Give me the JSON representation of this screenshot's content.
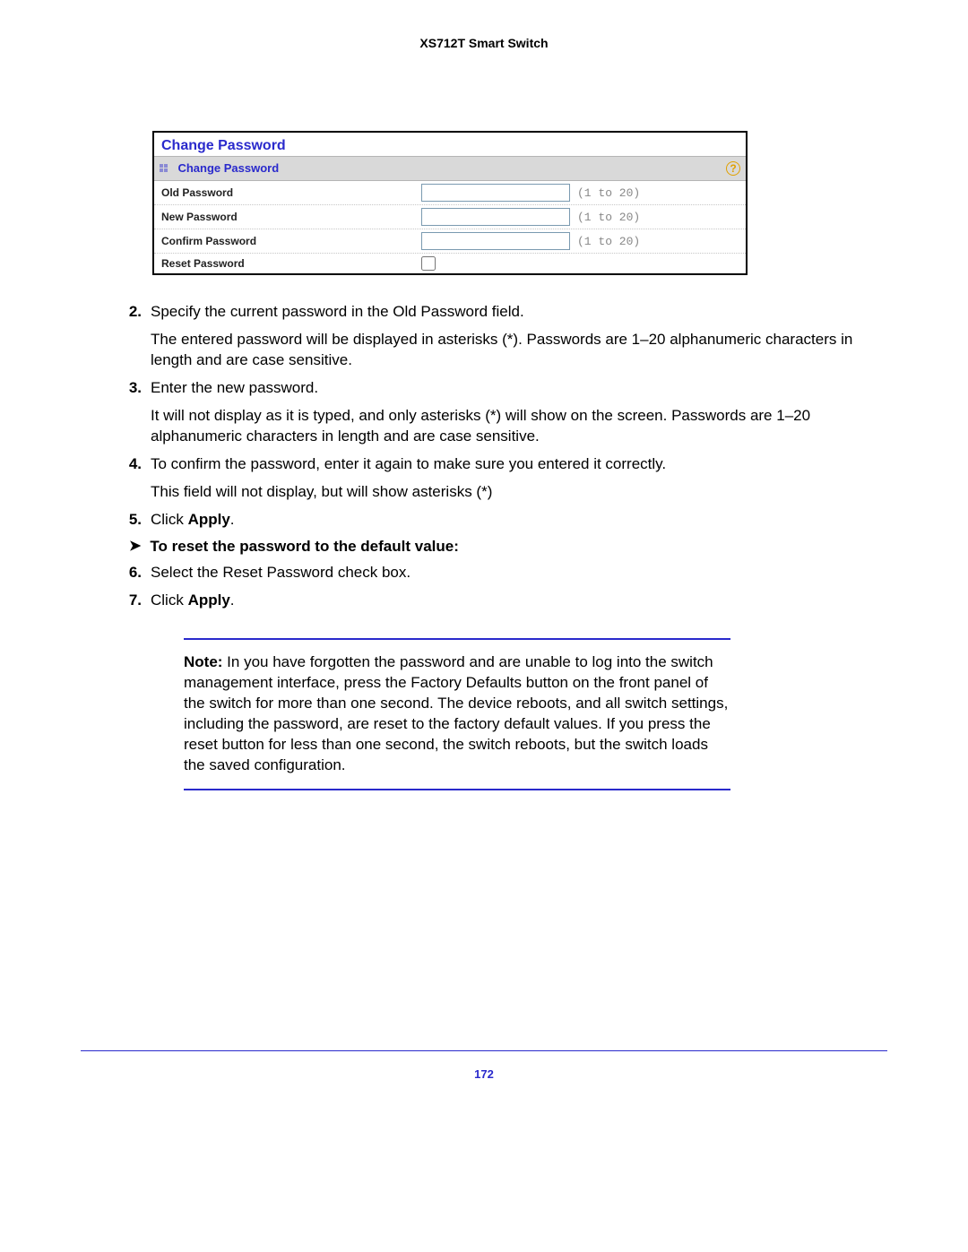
{
  "header": {
    "title": "XS712T Smart Switch"
  },
  "panel": {
    "title": "Change Password",
    "subhead": "Change Password",
    "rows": [
      {
        "label": "Old Password",
        "hint": "(1 to 20)",
        "type": "text"
      },
      {
        "label": "New Password",
        "hint": "(1 to 20)",
        "type": "text"
      },
      {
        "label": "Confirm Password",
        "hint": "(1 to 20)",
        "type": "text"
      },
      {
        "label": "Reset Password",
        "type": "checkbox"
      }
    ],
    "help_glyph": "?"
  },
  "steps": {
    "s2": {
      "num": "2.",
      "line1": "Specify the current password in the Old Password field.",
      "line2": "The entered password will be displayed in asterisks (*). Passwords are 1–20 alphanumeric characters in length and are case sensitive."
    },
    "s3": {
      "num": "3.",
      "line1": "Enter the new password.",
      "line2": "It will not display as it is typed, and only asterisks (*) will show on the screen. Passwords are 1–20 alphanumeric characters in length and are case sensitive."
    },
    "s4": {
      "num": "4.",
      "line1": "To confirm the password, enter it again to make sure you entered it correctly.",
      "line2": "This field will not display, but will show asterisks (*)"
    },
    "s5": {
      "num": "5.",
      "pre": "Click ",
      "bold": "Apply",
      "post": "."
    },
    "proc_head": "To reset the password to the default value:",
    "s6": {
      "num": "6.",
      "line1": "Select the Reset Password check box."
    },
    "s7": {
      "num": "7.",
      "pre": "Click ",
      "bold": "Apply",
      "post": "."
    }
  },
  "note": {
    "label": "Note:",
    "text": " In you have forgotten the password and are unable to log into the switch management interface, press the Factory Defaults button on the front panel of the switch for more than one second. The device reboots, and all switch settings, including the password, are reset to the factory default values. If you press the reset button for less than one second, the switch reboots, but the switch loads the saved configuration."
  },
  "page_number": "172"
}
